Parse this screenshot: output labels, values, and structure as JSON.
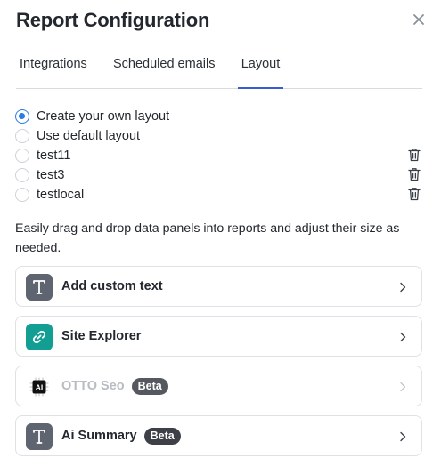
{
  "header": {
    "title": "Report Configuration"
  },
  "tabs": [
    {
      "label": "Integrations",
      "active": false
    },
    {
      "label": "Scheduled emails",
      "active": false
    },
    {
      "label": "Layout",
      "active": true
    }
  ],
  "layouts": [
    {
      "label": "Create your own layout",
      "checked": true,
      "deletable": false
    },
    {
      "label": "Use default layout",
      "checked": false,
      "deletable": false
    },
    {
      "label": "test11",
      "checked": false,
      "deletable": true
    },
    {
      "label": "test3",
      "checked": false,
      "deletable": true
    },
    {
      "label": "testlocal",
      "checked": false,
      "deletable": true
    }
  ],
  "description": "Easily drag and drop data panels into reports and adjust their size as needed.",
  "panels": [
    {
      "label": "Add custom text",
      "icon": "text-t-icon",
      "badge": null,
      "disabled": false
    },
    {
      "label": "Site Explorer",
      "icon": "link-icon",
      "badge": null,
      "disabled": false
    },
    {
      "label": "OTTO Seo",
      "icon": "ai-chip-icon",
      "badge": "Beta",
      "disabled": true
    },
    {
      "label": "Ai Summary",
      "icon": "text-t-icon",
      "badge": "Beta",
      "disabled": false
    }
  ],
  "colors": {
    "accent_blue": "#2b7be5",
    "tab_underline": "#3a5bd0",
    "text_icon_bg": "#5f6570",
    "link_icon_bg": "#139e94",
    "badge_bg": "#3d4047"
  }
}
